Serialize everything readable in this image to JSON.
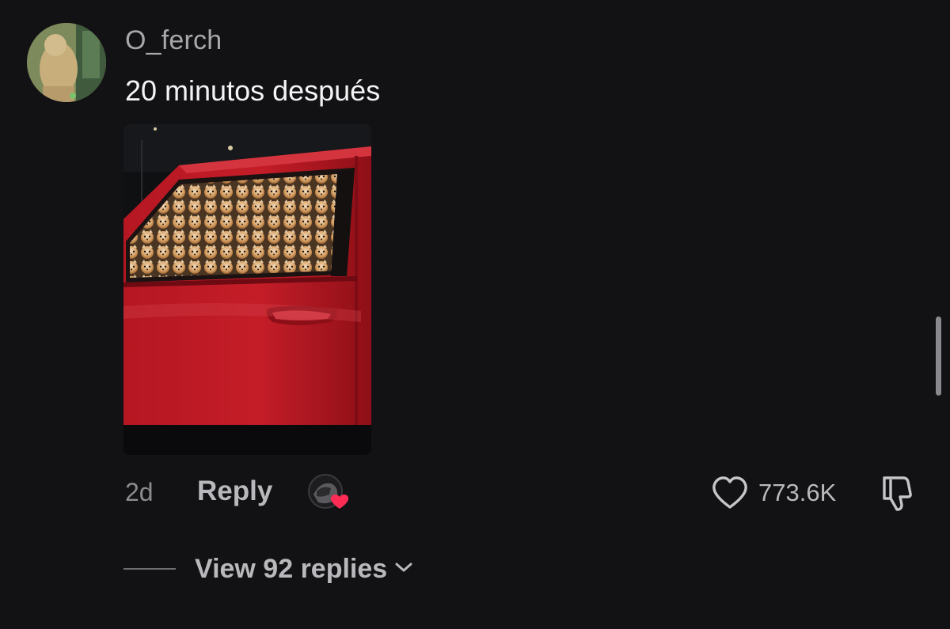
{
  "comment": {
    "username": "O_ferch",
    "text": "20 minutos después",
    "time": "2d",
    "reply_label": "Reply",
    "like_count": "773.6K",
    "view_replies_label": "View 92 replies"
  },
  "icons": {
    "avatar": "user-avatar",
    "creator_like": "creator-liked-heart-icon",
    "like": "heart-outline-icon",
    "dislike": "thumbs-down-icon",
    "expand": "chevron-down-icon"
  },
  "colors": {
    "background": "#121214",
    "heart_badge": "#fe2c55",
    "muted_text": "#a8a8ab",
    "primary_text": "#f4f4f5"
  }
}
